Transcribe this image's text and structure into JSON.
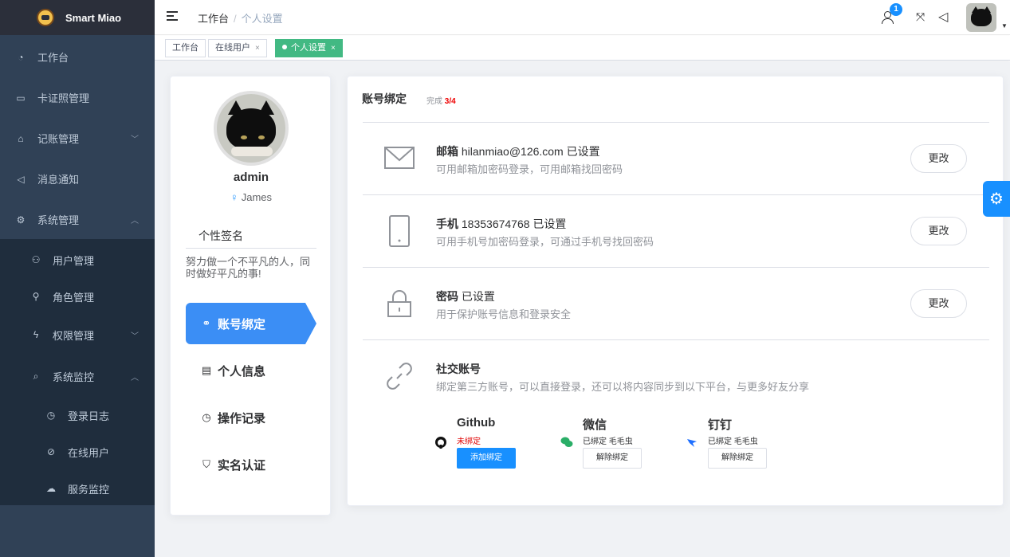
{
  "app": {
    "title": "Smart Miao"
  },
  "sidebar": {
    "items": [
      {
        "label": "工作台",
        "icon": "dashboard-icon"
      },
      {
        "label": "卡证照管理",
        "icon": "folder-icon"
      },
      {
        "label": "记账管理",
        "icon": "bank-icon"
      },
      {
        "label": "消息通知",
        "icon": "megaphone-icon"
      },
      {
        "label": "系统管理",
        "icon": "gear-icon"
      }
    ],
    "sub_items": [
      {
        "label": "用户管理",
        "icon": "user-icon"
      },
      {
        "label": "角色管理",
        "icon": "role-icon"
      },
      {
        "label": "权限管理",
        "icon": "lightning-icon"
      },
      {
        "label": "系统监控",
        "icon": "search-icon"
      }
    ],
    "monitor_items": [
      {
        "label": "登录日志",
        "icon": "clock-icon"
      },
      {
        "label": "在线用户",
        "icon": "link-icon"
      },
      {
        "label": "服务监控",
        "icon": "cloud-icon"
      }
    ]
  },
  "navbar": {
    "breadcrumb": [
      "工作台",
      "个人设置"
    ],
    "badge_count": "1"
  },
  "tags": [
    "工作台",
    "在线用户",
    "个人设置"
  ],
  "profile": {
    "username": "admin",
    "alias": "James",
    "signature_label": "个性签名",
    "signature": "努力做一个不平凡的人，同时做好平凡的事!",
    "nav": [
      "账号绑定",
      "个人信息",
      "操作记录",
      "实名认证"
    ]
  },
  "binding": {
    "title": "账号绑定",
    "progress_label": "完成",
    "progress_value": "3/4",
    "rows": [
      {
        "name": "邮箱",
        "value": "hilanmiao@126.com",
        "status": "已设置",
        "desc": "可用邮箱加密码登录，可用邮箱找回密码",
        "button": "更改"
      },
      {
        "name": "手机",
        "value": "18353674768",
        "status": "已设置",
        "desc": "可用手机号加密码登录，可通过手机号找回密码",
        "button": "更改"
      },
      {
        "name": "密码",
        "value": "",
        "status": "已设置",
        "desc": "用于保护账号信息和登录安全",
        "button": "更改"
      }
    ],
    "social": {
      "title": "社交账号",
      "desc": "绑定第三方账号，可以直接登录，还可以将内容同步到以下平台，与更多好友分享",
      "platforms": [
        {
          "name": "Github",
          "status": "未绑定",
          "button": "添加绑定",
          "status_color": "#e00000"
        },
        {
          "name": "微信",
          "status": "已绑定 毛毛虫",
          "button": "解除绑定",
          "status_color": "#303133"
        },
        {
          "name": "钉钉",
          "status": "已绑定 毛毛虫",
          "button": "解除绑定",
          "status_color": "#303133"
        }
      ]
    }
  },
  "colors": {
    "sidebar_bg": "#304156",
    "accent": "#1890ff",
    "tag_active": "#42b983"
  }
}
